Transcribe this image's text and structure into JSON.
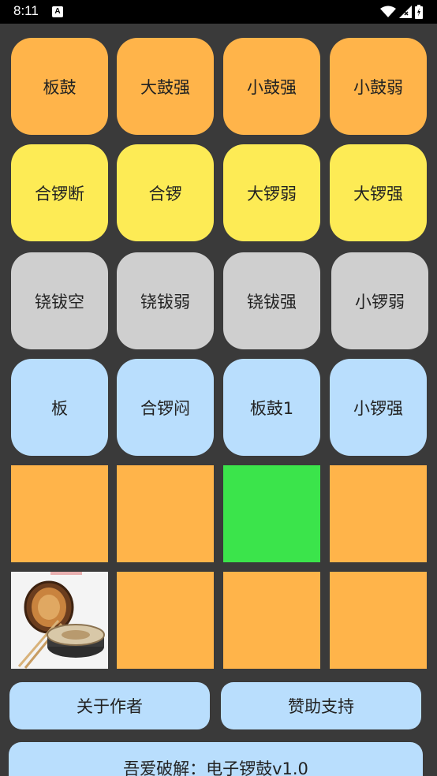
{
  "status_bar": {
    "time": "8:11",
    "notification_icon": "A",
    "icons": [
      "wifi-icon",
      "signal-icon",
      "battery-icon"
    ]
  },
  "pads": {
    "row1": [
      "板鼓",
      "大鼓强",
      "小鼓强",
      "小鼓弱"
    ],
    "row2": [
      "合锣断",
      "合锣",
      "大锣弱",
      "大锣强"
    ],
    "row3": [
      "铙钹空",
      "铙钹弱",
      "铙钹强",
      "小锣弱"
    ],
    "row4": [
      "板",
      "合锣闷",
      "板鼓1",
      "小锣强"
    ]
  },
  "colors": {
    "orange": "#ffb44a",
    "yellow": "#fdeb55",
    "gray": "#cfcfcf",
    "blue": "#b9defd",
    "green": "#3be44b",
    "background": "#3a3a3a"
  },
  "tiles": {
    "row5": [
      "orange",
      "orange",
      "green",
      "orange"
    ],
    "row6": [
      "drum-image",
      "orange",
      "orange",
      "orange"
    ]
  },
  "buttons": {
    "about_author": "关于作者",
    "sponsor": "赞助支持",
    "footer_title": "吾爱破解：电子锣鼓v1.0"
  }
}
